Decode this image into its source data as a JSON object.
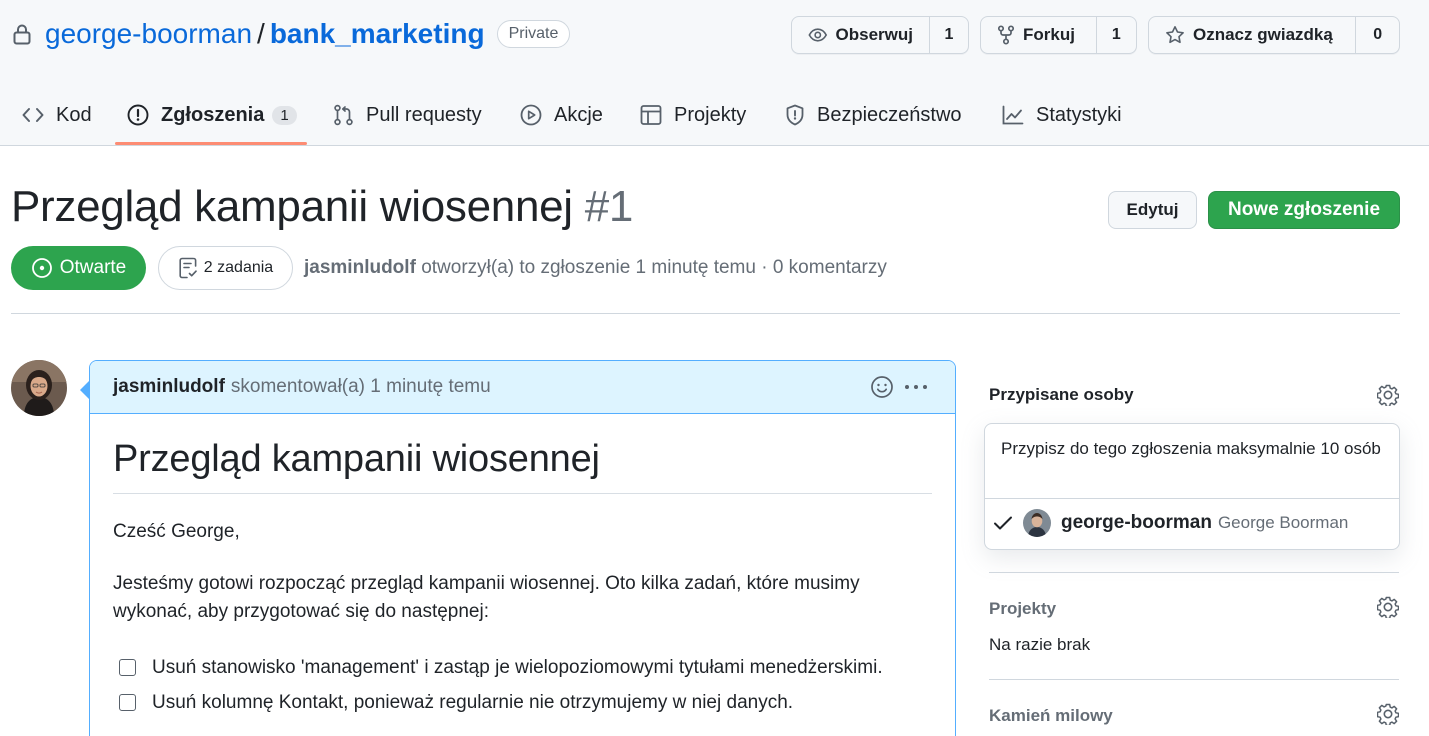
{
  "repo": {
    "owner": "george-boorman",
    "separator": "/",
    "name": "bank_marketing",
    "visibility": "Private"
  },
  "repo_actions": {
    "watch_label": "Obserwuj",
    "watch_count": "1",
    "fork_label": "Forkuj",
    "fork_count": "1",
    "star_label": "Oznacz gwiazdką",
    "star_count": "0"
  },
  "tabs": [
    {
      "label": "Kod",
      "icon": "code-icon"
    },
    {
      "label": "Zgłoszenia",
      "icon": "issue-icon",
      "counter": "1",
      "selected": true
    },
    {
      "label": "Pull requesty",
      "icon": "pull-request-icon"
    },
    {
      "label": "Akcje",
      "icon": "play-icon"
    },
    {
      "label": "Projekty",
      "icon": "table-icon"
    },
    {
      "label": "Bezpieczeństwo",
      "icon": "shield-icon"
    },
    {
      "label": "Statystyki",
      "icon": "graph-icon"
    }
  ],
  "issue": {
    "title": "Przegląd kampanii wiosennej",
    "number": "#1",
    "edit_label": "Edytuj",
    "new_label": "Nowe zgłoszenie",
    "state": "Otwarte",
    "tasks": "2 zadania",
    "author": "jasminludolf",
    "opened_text": "otworzył(a) to zgłoszenie 1 minutę temu · 0 komentarzy"
  },
  "comment": {
    "author": "jasminludolf",
    "action_text": "skomentował(a) 1 minutę temu",
    "heading": "Przegląd kampanii wiosennej",
    "greeting": "Cześć George,",
    "intro": "Jesteśmy gotowi rozpocząć przegląd kampanii wiosennej. Oto kilka zadań, które musimy wykonać, aby przygotować się do następnej:",
    "tasks": [
      "Usuń stanowisko 'management' i zastąp je wielopoziomowymi tytułami menedżerskimi.",
      "Usuń kolumnę Kontakt, ponieważ regularnie nie otrzymujemy w niej danych."
    ]
  },
  "sidebar": {
    "assignees_heading": "Przypisane osoby",
    "assignees_hint": "Przypisz do tego zgłoszenia maksymalnie 10 osób",
    "assignee_login": "george-boorman",
    "assignee_name": "George Boorman",
    "projects_heading": "Projekty",
    "projects_value": "Na razie brak",
    "milestone_heading": "Kamień milowy"
  },
  "colors": {
    "accent_link": "#0969da",
    "open_green": "#2da44e",
    "tab_underline": "#fd8c73",
    "comment_header_bg": "#ddf4ff"
  }
}
